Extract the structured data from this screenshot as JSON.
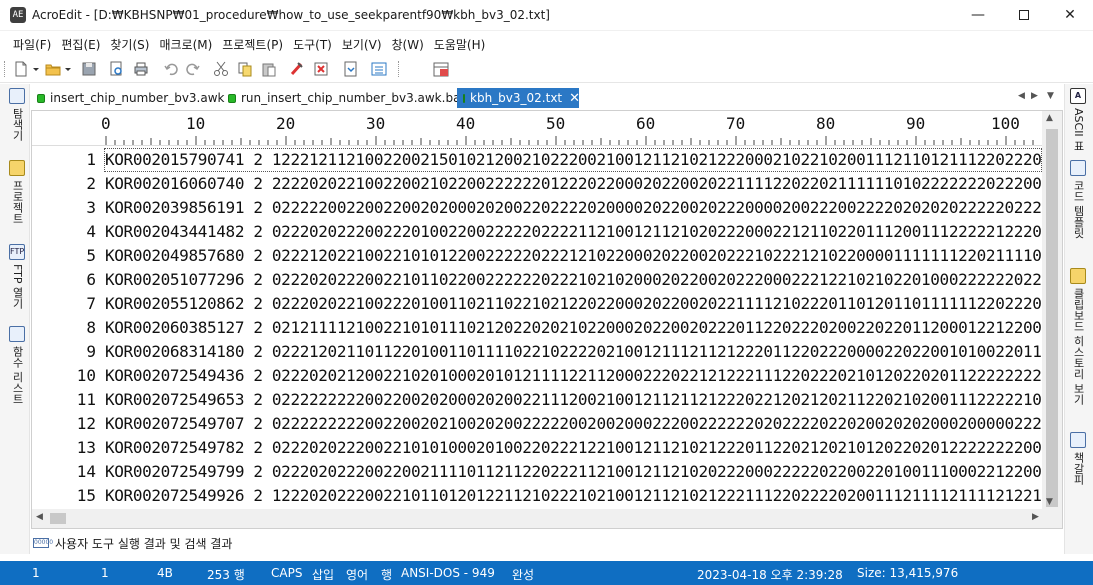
{
  "window": {
    "app_icon": "AE",
    "title": "AcroEdit - [D:₩KBHSNP₩01_procedure₩how_to_use_seekparentf90₩kbh_bv3_02.txt]",
    "minimize": "—",
    "close": "✕"
  },
  "menu": [
    "파일(F)",
    "편집(E)",
    "찾기(S)",
    "매크로(M)",
    "프로젝트(P)",
    "도구(T)",
    "보기(V)",
    "창(W)",
    "도움말(H)"
  ],
  "toolbar": {
    "icons": [
      "new-file-icon",
      "open-folder-icon",
      "save-icon",
      "print-preview-icon",
      "print-icon",
      "undo-icon",
      "redo-icon",
      "cut-icon",
      "copy-icon",
      "paste-icon",
      "clear-icon",
      "bookmark-icon",
      "macro-icon",
      "options-icon",
      "calendar-icon"
    ]
  },
  "left_panel": {
    "tabs": [
      {
        "icon": "search-window-icon",
        "label": "탐색기"
      },
      {
        "icon": "project-icon",
        "label": "프로젝트"
      },
      {
        "icon": "ftp-icon",
        "icon_text": "FTP",
        "label": "FTP 열기"
      },
      {
        "icon": "function-list-icon",
        "label": "함수 리스트"
      }
    ]
  },
  "right_panel": {
    "tabs": [
      {
        "icon": "ascii-table-icon",
        "icon_text": "A",
        "label": "ASCII 표"
      },
      {
        "icon": "code-template-icon",
        "label": "코드 템플릿"
      },
      {
        "icon": "clipboard-history-icon",
        "label": "클립보드 히스토리 보기"
      },
      {
        "icon": "bookmark-list-icon",
        "label": "책갈피"
      }
    ]
  },
  "tabs": [
    {
      "label": "insert_chip_number_bv3.awk",
      "active": false
    },
    {
      "label": "run_insert_chip_number_bv3.awk.bat",
      "active": false
    },
    {
      "label": "kbh_bv3_02.txt",
      "active": true,
      "close": "✕"
    }
  ],
  "tab_nav": {
    "prev": "◀",
    "next": "▶",
    "menu": "▼"
  },
  "ruler": [
    "0",
    "10",
    "20",
    "30",
    "40",
    "50",
    "60",
    "70",
    "80",
    "90",
    "100"
  ],
  "lines": [
    {
      "no": "1",
      "text": "KOR002015790741 2 1222121121002200215010212002102220021001211210212220002102210200111211012111220222001022"
    },
    {
      "no": "2",
      "text": "KOR002016060740 2 2222020221002200210220022222201222022000202200202211112202202111111010222222202220010"
    },
    {
      "no": "3",
      "text": "KOR002039856191 2 0222220022002200202000202002202222020000202200202220000200222002222020202022222022200000"
    },
    {
      "no": "4",
      "text": "KOR002043441482 2 0222020222002220100220022222022221121001211210202220002212110220111200111222221222002011"
    },
    {
      "no": "5",
      "text": "KOR002049857680 2 0222120221002210101220022222022212102200020220020222102221210220000111111122021111010"
    },
    {
      "no": "6",
      "text": "KOR002051077296 2 0222020222002210110220022222202221021020002022002022200022212210210220100022222202220011"
    },
    {
      "no": "7",
      "text": "KOR002055120862 2 0222020221002220100110211022102122022000202200202211112102220110120110111111220222001122"
    },
    {
      "no": "8",
      "text": "KOR002060385127 2 0212111121002210101110212022020210220002022002022201122022202002202201120001221220020011"
    },
    {
      "no": "9",
      "text": "KOR002068314180 2 0222120211011220100110111102210222202100121112112122201122022200002202200101002201110001"
    },
    {
      "no": "10",
      "text": "KOR002072549436 2 0222020212002210201000201012111122112000222022121222111220222021012022020112222222200211"
    },
    {
      "no": "11",
      "text": "KOR002072549653 2 0222222222002200202000202002211120021001211211212220221202120211220210200111222221002022"
    },
    {
      "no": "12",
      "text": "KOR002072549707 2 0222222222002200202100202002222200200200022200222222020222202202002020200020000022200020"
    },
    {
      "no": "13",
      "text": "KOR002072549782 2 0222020222002210101000201002202221221001211210212220112202120210120220201222222220011110"
    },
    {
      "no": "14",
      "text": "KOR002072549799 2 0222020222002200211110112112202221121001211210202220002222202200220100111000221220002012"
    },
    {
      "no": "15",
      "text": "KOR002072549926 2 1222020222002210110120122112102221021001211210212221112202222020011121111211112122100201"
    }
  ],
  "scroll": {
    "up": "▲",
    "down": "▼",
    "left": "◀",
    "right": "▶"
  },
  "output_panel": {
    "icon_text": "00000",
    "label": "사용자 도구 실행 결과 및 검색 결과"
  },
  "status": {
    "line": "1",
    "column": "1",
    "bytes": "4B",
    "lines": "253 행",
    "caps": "CAPS",
    "insert": "삽입",
    "lang": "영어",
    "mode": "행",
    "encoding": "ANSI-DOS - 949",
    "state": "완성",
    "datetime": "2023-04-18 오후 2:39:28",
    "size": "Size: 13,415,976"
  }
}
